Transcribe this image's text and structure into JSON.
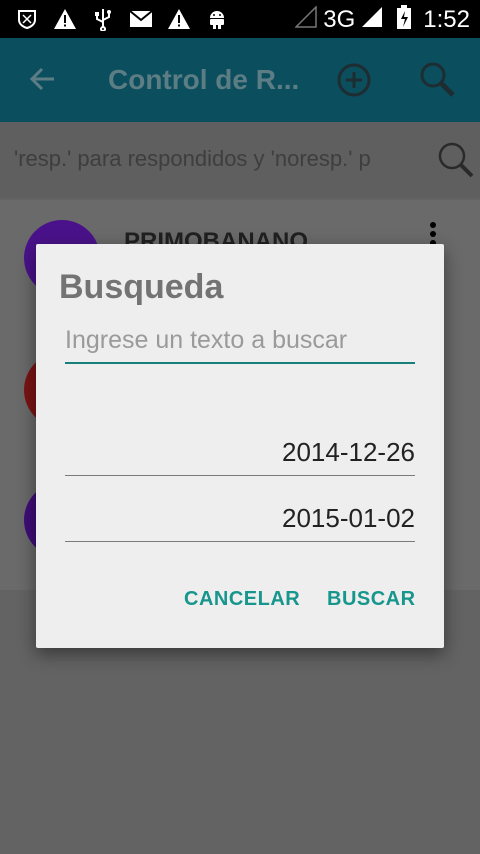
{
  "status_bar": {
    "network": "3G",
    "time": "1:52"
  },
  "app_bar": {
    "title": "Control de R..."
  },
  "search_strip": {
    "text": "'resp.' para respondidos y 'noresp.' p"
  },
  "list": {
    "first_item_name": "PRIMOBANANO",
    "avatar_colors": [
      "#4a128a",
      "#7a1414",
      "#3f0d78"
    ]
  },
  "dialog": {
    "title": "Busqueda",
    "search_placeholder": "Ingrese un texto a buscar",
    "date_from": "2014-12-26",
    "date_to": "2015-01-02",
    "cancel_label": "CANCELAR",
    "search_label": "BUSCAR"
  },
  "colors": {
    "accent": "#17968d",
    "app_bar": "#0b4e5e"
  }
}
